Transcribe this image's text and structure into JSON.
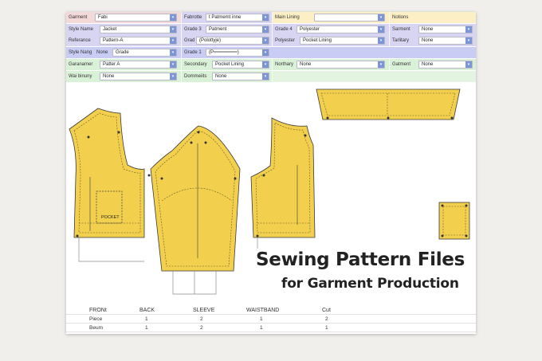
{
  "form": {
    "row1": [
      {
        "label": "Garment",
        "value": "Fabi"
      },
      {
        "label": "Fabrotte",
        "value": "t Patmemt inne"
      },
      {
        "label": "Main Lining",
        "value": ""
      },
      {
        "label": "Notions",
        "value": ""
      }
    ],
    "row2": [
      {
        "label": "Style Name",
        "value": "Jacket"
      },
      {
        "label": "Grade 3",
        "value": "Patment"
      },
      {
        "label": "Grade 4",
        "value": "Polyester"
      },
      {
        "label": "Sarment",
        "value": "None"
      }
    ],
    "row3": [
      {
        "label": "Referance",
        "value": "Pattern-A"
      },
      {
        "label": "Grad",
        "value": "(Polottyje)"
      },
      {
        "label": "Polyester",
        "value": "Pocket Lining"
      },
      {
        "label": "Tarlitary",
        "value": "None"
      }
    ],
    "row4": [
      {
        "label": "Style Nang",
        "value": "None"
      },
      {
        "label": "",
        "value": "Grade"
      },
      {
        "label": "Grade 1",
        "value": "(P═══════)"
      }
    ],
    "row5": [
      {
        "label": "Garanamer",
        "value": "Patter A"
      },
      {
        "label": "Secondary",
        "value": "Pocket Lining"
      },
      {
        "label": "Northary",
        "value": "None"
      },
      {
        "label": "Gatment",
        "value": "None"
      }
    ],
    "row6": [
      {
        "label": "Wai binuny",
        "value": "None"
      },
      {
        "label": "Dommeiits",
        "value": "None"
      }
    ]
  },
  "pattern": {
    "pocket_label": "POCKET",
    "fill_color": "#f2d04e",
    "outline_color": "#3a3a3a"
  },
  "headline": {
    "line1": "Sewing Pattern Files",
    "line2": "for Garment Production"
  },
  "table": {
    "headers": [
      "FRONt",
      "BACK",
      "SLEEVE",
      "WAISTBAND",
      "Cut"
    ],
    "rows": [
      {
        "label": "Piece",
        "values": [
          "1",
          "2",
          "1",
          "2"
        ]
      },
      {
        "label": "Beum",
        "values": [
          "1",
          "2",
          "1",
          "1"
        ]
      }
    ]
  }
}
